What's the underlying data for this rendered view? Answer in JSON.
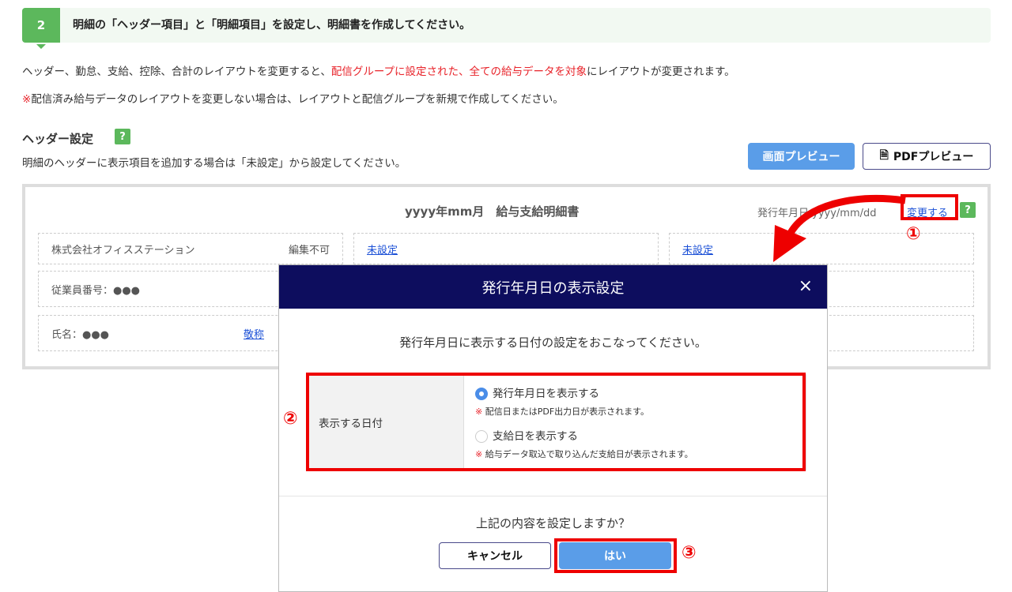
{
  "step": {
    "number": "2",
    "title": "明細の「ヘッダー項目」と「明細項目」を設定し、明細書を作成してください。"
  },
  "notice": {
    "line1_pre": "ヘッダー、勤怠、支給、控除、合計のレイアウトを変更すると、",
    "line1_red": "配信グループに設定された、全ての給与データを対象",
    "line1_post": "にレイアウトが変更されます。",
    "line2_mark": "※",
    "line2": "配信済み給与データのレイアウトを変更しない場合は、レイアウトと配信グループを新規で作成してください。"
  },
  "header_settings": {
    "title": "ヘッダー設定",
    "help": "?",
    "desc": "明細のヘッダーに表示項目を追加する場合は「未設定」から設定してください。",
    "screen_preview": "画面プレビュー",
    "pdf_preview": "PDFプレビュー"
  },
  "preview": {
    "doc_title": "yyyy年mm月　給与支給明細書",
    "issue_label": "発行年月日",
    "issue_value": "yyyy/mm/dd",
    "change_link": "変更する",
    "help": "?",
    "company": "株式会社オフィスステーション",
    "not_editable": "編集不可",
    "unset1": "未設定",
    "unset2": "未設定",
    "employee_no": "従業員番号：●●●",
    "name": "氏名：●●●",
    "honorific": "敬称"
  },
  "modal": {
    "title": "発行年月日の表示設定",
    "close": "×",
    "instruction": "発行年月日に表示する日付の設定をおこなってください。",
    "row_label": "表示する日付",
    "option1": "発行年月日を表示する",
    "option1_note": "配信日またはPDF出力日が表示されます。",
    "option2": "支給日を表示する",
    "option2_note": "給与データ取込で取り込んだ支給日が表示されます。",
    "note_mark": "※",
    "confirm": "上記の内容を設定しますか？",
    "cancel": "キャンセル",
    "ok": "はい"
  },
  "annotations": {
    "a1": "①",
    "a2": "②",
    "a3": "③"
  }
}
